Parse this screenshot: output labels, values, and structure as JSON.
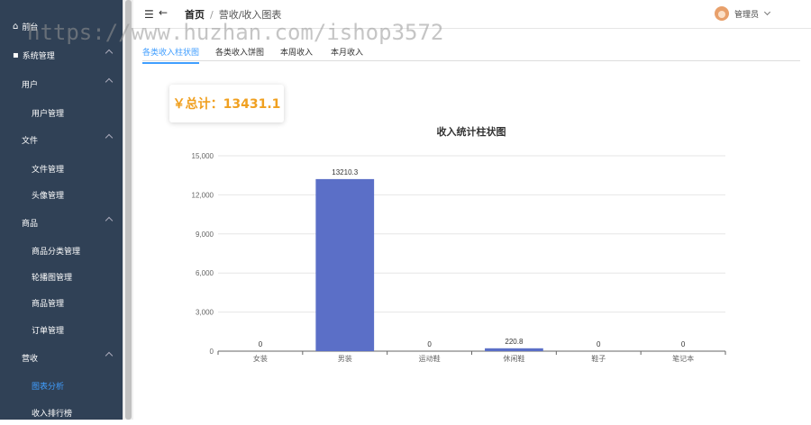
{
  "sidebar": {
    "items": [
      {
        "label": "前台",
        "icon": "home-icon",
        "level": "top"
      },
      {
        "label": "系统管理",
        "icon": "grid-icon",
        "level": "top"
      },
      {
        "label": "用户",
        "level": "group"
      },
      {
        "label": "用户管理",
        "level": "sub"
      },
      {
        "label": "文件",
        "level": "group"
      },
      {
        "label": "文件管理",
        "level": "sub"
      },
      {
        "label": "头像管理",
        "level": "sub"
      },
      {
        "label": "商品",
        "level": "group"
      },
      {
        "label": "商品分类管理",
        "level": "sub"
      },
      {
        "label": "轮播图管理",
        "level": "sub"
      },
      {
        "label": "商品管理",
        "level": "sub"
      },
      {
        "label": "订单管理",
        "level": "sub"
      },
      {
        "label": "营收",
        "level": "group"
      },
      {
        "label": "图表分析",
        "level": "sub",
        "active": true
      },
      {
        "label": "收入排行榜",
        "level": "sub"
      }
    ]
  },
  "header": {
    "menu_icon": "hamburger-icon",
    "back_icon": "arrow-left-icon",
    "breadcrumb_home": "首页",
    "breadcrumb_sep": "/",
    "breadcrumb_current": "营收/收入图表",
    "user_name": "管理员"
  },
  "watermark": "https://www.huzhan.com/ishop3572",
  "tabs": [
    {
      "label": "各类收入柱状图",
      "active": true
    },
    {
      "label": "各类收入饼图"
    },
    {
      "label": "本周收入"
    },
    {
      "label": "本月收入"
    }
  ],
  "total_label": "￥总计：13431.1",
  "accent": "#409eff",
  "bar_color": "#5b6fc7",
  "chart_data": {
    "type": "bar",
    "title": "收入统计柱状图",
    "categories": [
      "女装",
      "男装",
      "运动鞋",
      "休闲鞋",
      "鞋子",
      "笔记本"
    ],
    "values": [
      0,
      13210.3,
      0,
      220.8,
      0,
      0
    ],
    "data_labels": [
      "0",
      "13210.3",
      "0",
      "220.8",
      "0",
      "0"
    ],
    "ylim": [
      0,
      15000
    ],
    "yticks": [
      "0",
      "3,000",
      "6,000",
      "9,000",
      "12,000",
      "15,000"
    ],
    "ytick_values": [
      0,
      3000,
      6000,
      9000,
      12000,
      15000
    ],
    "grid": true
  }
}
